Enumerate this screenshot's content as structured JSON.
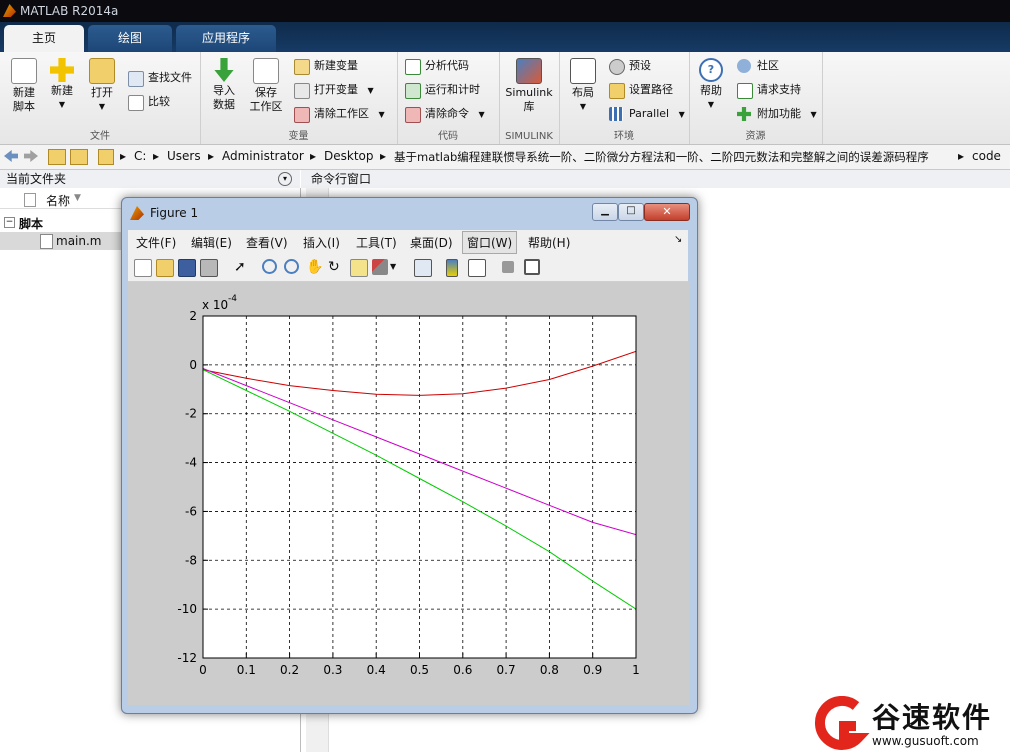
{
  "app": {
    "title": "MATLAB R2014a"
  },
  "tabs": [
    "主页",
    "绘图",
    "应用程序"
  ],
  "ribbon": {
    "file_group": {
      "label": "文件",
      "new_script": "新建\n脚本",
      "new": "新建",
      "open": "打开",
      "find_files": "查找文件",
      "compare": "比较"
    },
    "var_group": {
      "label": "变量",
      "import": "导入\n数据",
      "save_ws": "保存\n工作区",
      "new_var": "新建变量",
      "open_var": "打开变量",
      "clear_ws": "清除工作区"
    },
    "code_group": {
      "label": "代码",
      "analyze": "分析代码",
      "run_time": "运行和计时",
      "clear_cmd": "清除命令"
    },
    "simulink_group": {
      "label": "SIMULINK",
      "simulink": "Simulink\n库"
    },
    "env_group": {
      "label": "环境",
      "layout": "布局",
      "prefs": "预设",
      "set_path": "设置路径",
      "parallel": "Parallel"
    },
    "res_group": {
      "label": "资源",
      "help": "帮助",
      "community": "社区",
      "request_support": "请求支持",
      "addons": "附加功能"
    }
  },
  "address": {
    "segments": [
      "C:",
      "Users",
      "Administrator",
      "Desktop",
      "基于matlab编程建联惯导系统一阶、二阶微分方程法和一阶、二阶四元数法和完整解之间的误差源码程序",
      "code"
    ]
  },
  "left_panel": {
    "title": "当前文件夹",
    "col_header": "名称",
    "group": "脚本",
    "file": "main.m"
  },
  "cmd_panel": {
    "title": "命令行窗口"
  },
  "figure": {
    "title": "Figure 1",
    "menu": [
      "文件(F)",
      "编辑(E)",
      "查看(V)",
      "插入(I)",
      "工具(T)",
      "桌面(D)",
      "窗口(W)",
      "帮助(H)"
    ]
  },
  "chart_data": {
    "type": "line",
    "xlim": [
      0,
      1
    ],
    "ylim": [
      -12,
      2
    ],
    "scale_label": "x 10",
    "scale_exp": "-4",
    "xticks": [
      "0",
      "0.1",
      "0.2",
      "0.3",
      "0.4",
      "0.5",
      "0.6",
      "0.7",
      "0.8",
      "0.9",
      "1"
    ],
    "yticks": [
      "2",
      "0",
      "-2",
      "-4",
      "-6",
      "-8",
      "-10",
      "-12"
    ],
    "grid": true,
    "series": [
      {
        "color": "#cc0000",
        "x": [
          0,
          0.1,
          0.2,
          0.3,
          0.4,
          0.5,
          0.6,
          0.7,
          0.8,
          0.9,
          1.0
        ],
        "y": [
          -0.2,
          -0.55,
          -0.85,
          -1.05,
          -1.2,
          -1.25,
          -1.18,
          -0.95,
          -0.6,
          -0.05,
          0.55
        ]
      },
      {
        "color": "#cc00cc",
        "x": [
          0,
          0.1,
          0.2,
          0.3,
          0.4,
          0.5,
          0.6,
          0.7,
          0.8,
          0.9,
          1.0
        ],
        "y": [
          -0.15,
          -0.85,
          -1.55,
          -2.25,
          -2.95,
          -3.65,
          -4.35,
          -5.05,
          -5.75,
          -6.45,
          -6.95
        ]
      },
      {
        "color": "#00cc00",
        "x": [
          0,
          0.1,
          0.2,
          0.3,
          0.4,
          0.5,
          0.6,
          0.7,
          0.8,
          0.9,
          1.0
        ],
        "y": [
          -0.2,
          -1.05,
          -1.9,
          -2.8,
          -3.7,
          -4.65,
          -5.6,
          -6.6,
          -7.65,
          -8.85,
          -10.0
        ]
      }
    ]
  },
  "watermark": {
    "name": "谷速软件",
    "url": "www.gusuoft.com"
  }
}
